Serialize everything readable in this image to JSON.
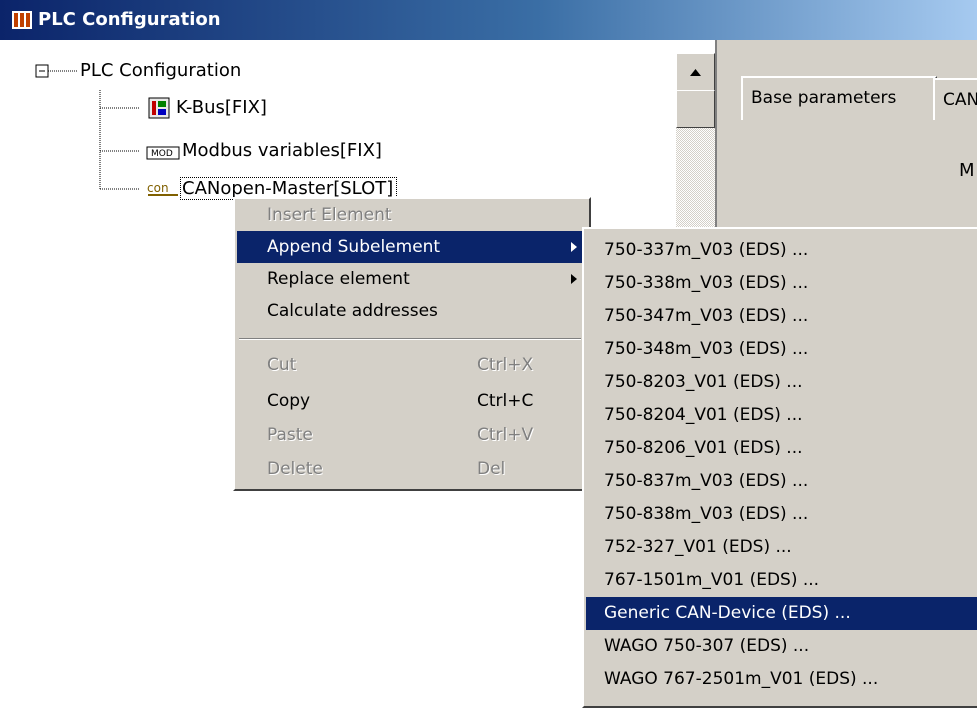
{
  "window": {
    "title": "PLC Configuration"
  },
  "tree": {
    "root": "PLC Configuration",
    "items": [
      {
        "label": "K-Bus[FIX]",
        "icon": "kbus-module-icon"
      },
      {
        "label": "Modbus variables[FIX]",
        "icon": "modbus-icon"
      },
      {
        "label": "CANopen-Master[SLOT]",
        "icon": "canopen-icon"
      }
    ]
  },
  "right_panel": {
    "tabs": [
      "Base parameters",
      "CAN"
    ],
    "partial_label": "M"
  },
  "context_menu": {
    "items": [
      {
        "label": "Insert Element",
        "enabled": false
      },
      {
        "label": "Append Subelement",
        "submenu": true,
        "selected": true
      },
      {
        "label": "Replace element",
        "submenu": true
      },
      {
        "label": "Calculate addresses"
      },
      {
        "label": "Cut",
        "shortcut": "Ctrl+X",
        "enabled": false
      },
      {
        "label": "Copy",
        "shortcut": "Ctrl+C"
      },
      {
        "label": "Paste",
        "shortcut": "Ctrl+V",
        "enabled": false
      },
      {
        "label": "Delete",
        "shortcut": "Del",
        "enabled": false
      }
    ]
  },
  "submenu": {
    "items": [
      "750-337m_V03 (EDS) ...",
      "750-338m_V03 (EDS) ...",
      "750-347m_V03 (EDS) ...",
      "750-348m_V03 (EDS) ...",
      "750-8203_V01 (EDS) ...",
      "750-8204_V01 (EDS) ...",
      "750-8206_V01 (EDS) ...",
      "750-837m_V03 (EDS) ...",
      "750-838m_V03 (EDS) ...",
      "752-327_V01 (EDS) ...",
      "767-1501m_V01 (EDS) ...",
      "Generic CAN-Device (EDS) ...",
      "WAGO 750-307 (EDS) ...",
      "WAGO 767-2501m_V01 (EDS) ..."
    ],
    "selected_index": 11
  },
  "colors": {
    "titlebar": "#0a246a",
    "selection": "#0a246a",
    "menu_bg": "#d4d0c8"
  }
}
